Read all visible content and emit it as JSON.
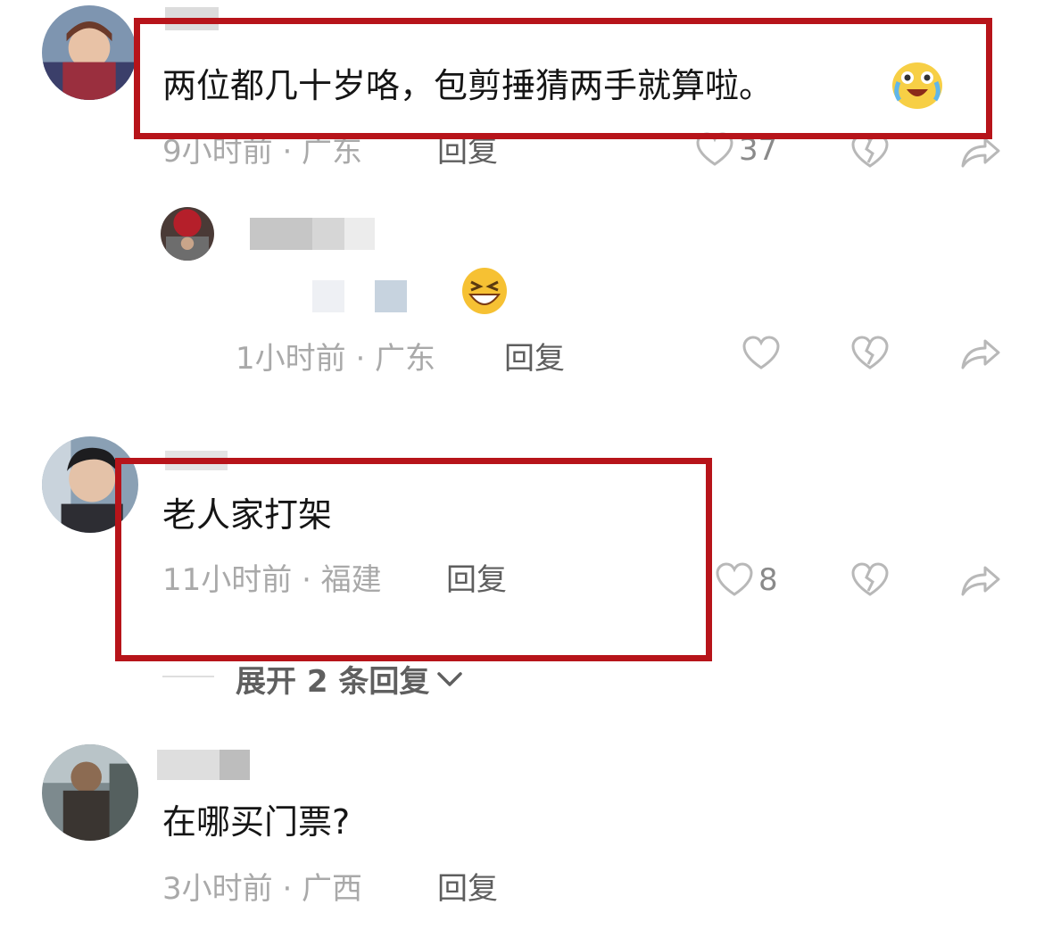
{
  "comments": [
    {
      "text": "两位都几十岁咯，包剪捶猜两手就算啦。",
      "meta": "9小时前 · 广东",
      "reply_label": "回复",
      "like_count": "37",
      "emoji": "crying-laughing-emoji",
      "replies": [
        {
          "meta": "1小时前 · 广东",
          "reply_label": "回复",
          "emoji": "grinning-squint-emoji"
        }
      ]
    },
    {
      "text": "老人家打架",
      "meta": "11小时前 · 福建",
      "reply_label": "回复",
      "like_count": "8",
      "expand_label": "展开 2 条回复"
    },
    {
      "text": "在哪买门票?",
      "meta": "3小时前 · 广西",
      "reply_label": "回复"
    }
  ],
  "colors": {
    "highlight": "#b7141a",
    "meta_text": "#a9a9a9",
    "reply_text": "#5e5e5e",
    "icon_stroke": "#b8b8b8"
  },
  "icons": [
    "heart-icon",
    "broken-heart-icon",
    "share-icon",
    "chevron-down-icon"
  ]
}
